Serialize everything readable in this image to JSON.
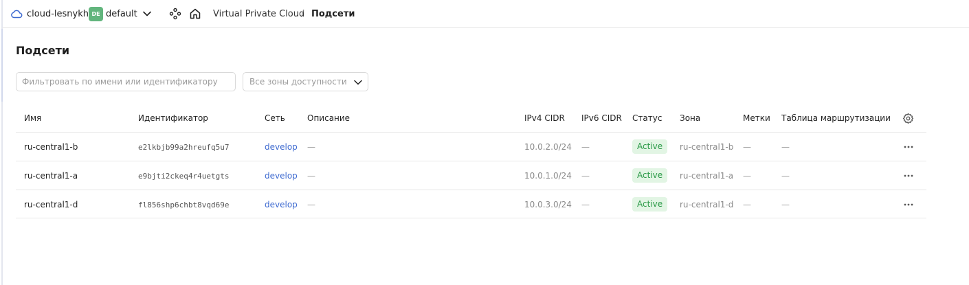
{
  "header": {
    "cloud_name": "cloud-lesnykh",
    "folder_badge": "DE",
    "folder_name": "default",
    "breadcrumbs": [
      "Virtual Private Cloud",
      "/",
      "Подсети"
    ],
    "colors": {
      "folder_badge": "#62b57d",
      "cloud_icon": "#3e6ad0"
    }
  },
  "page": {
    "title": "Подсети"
  },
  "filters": {
    "search_placeholder": "Фильтровать по имени или идентификатору",
    "search_value": "",
    "zone_select_value": "Все зоны доступности"
  },
  "table": {
    "columns": [
      "Имя",
      "Идентификатор",
      "Сеть",
      "Описание",
      "IPv4 CIDR",
      "IPv6 CIDR",
      "Статус",
      "Зона",
      "Метки",
      "Таблица маршрутизации"
    ],
    "rows": [
      {
        "name": "ru-central1-b",
        "id": "e2lkbjb99a2hreufq5u7",
        "network": "develop",
        "description": "—",
        "ipv4": "10.0.2.0/24",
        "ipv6": "—",
        "status": "Active",
        "zone": "ru-central1-b",
        "labels": "—",
        "route_table": "—"
      },
      {
        "name": "ru-central1-a",
        "id": "e9bjti2ckeq4r4uetgts",
        "network": "develop",
        "description": "—",
        "ipv4": "10.0.1.0/24",
        "ipv6": "—",
        "status": "Active",
        "zone": "ru-central1-a",
        "labels": "—",
        "route_table": "—"
      },
      {
        "name": "ru-central1-d",
        "id": "fl856shp6chbt8vqd69e",
        "network": "develop",
        "description": "—",
        "ipv4": "10.0.3.0/24",
        "ipv6": "—",
        "status": "Active",
        "zone": "ru-central1-d",
        "labels": "—",
        "route_table": "—"
      }
    ],
    "colors": {
      "status_active_bg": "#e2f5e4",
      "status_active_text": "#2b9a47",
      "link": "#3e6ad0"
    }
  }
}
